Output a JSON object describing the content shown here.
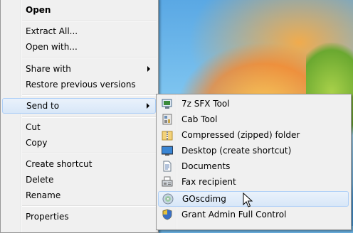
{
  "context_menu": {
    "items": [
      {
        "label": "Open"
      },
      {
        "label": "Extract All..."
      },
      {
        "label": "Open with..."
      },
      {
        "label": "Share with"
      },
      {
        "label": "Restore previous versions"
      },
      {
        "label": "Send to"
      },
      {
        "label": "Cut"
      },
      {
        "label": "Copy"
      },
      {
        "label": "Create shortcut"
      },
      {
        "label": "Delete"
      },
      {
        "label": "Rename"
      },
      {
        "label": "Properties"
      }
    ]
  },
  "send_to_menu": {
    "items": [
      {
        "label": "7z SFX Tool",
        "icon": "sfx-tool-icon"
      },
      {
        "label": "Cab Tool",
        "icon": "cab-tool-icon"
      },
      {
        "label": "Compressed (zipped) folder",
        "icon": "zip-folder-icon"
      },
      {
        "label": "Desktop (create shortcut)",
        "icon": "desktop-icon"
      },
      {
        "label": "Documents",
        "icon": "documents-icon"
      },
      {
        "label": "Fax recipient",
        "icon": "fax-icon"
      },
      {
        "label": "GOscdimg",
        "icon": "disc-icon"
      },
      {
        "label": "Grant Admin Full Control",
        "icon": "shield-icon"
      }
    ]
  },
  "colors": {
    "menu_bg": "#f0f0f0",
    "highlight_border": "#aecff7",
    "highlight_bg": "#dce9f9"
  }
}
